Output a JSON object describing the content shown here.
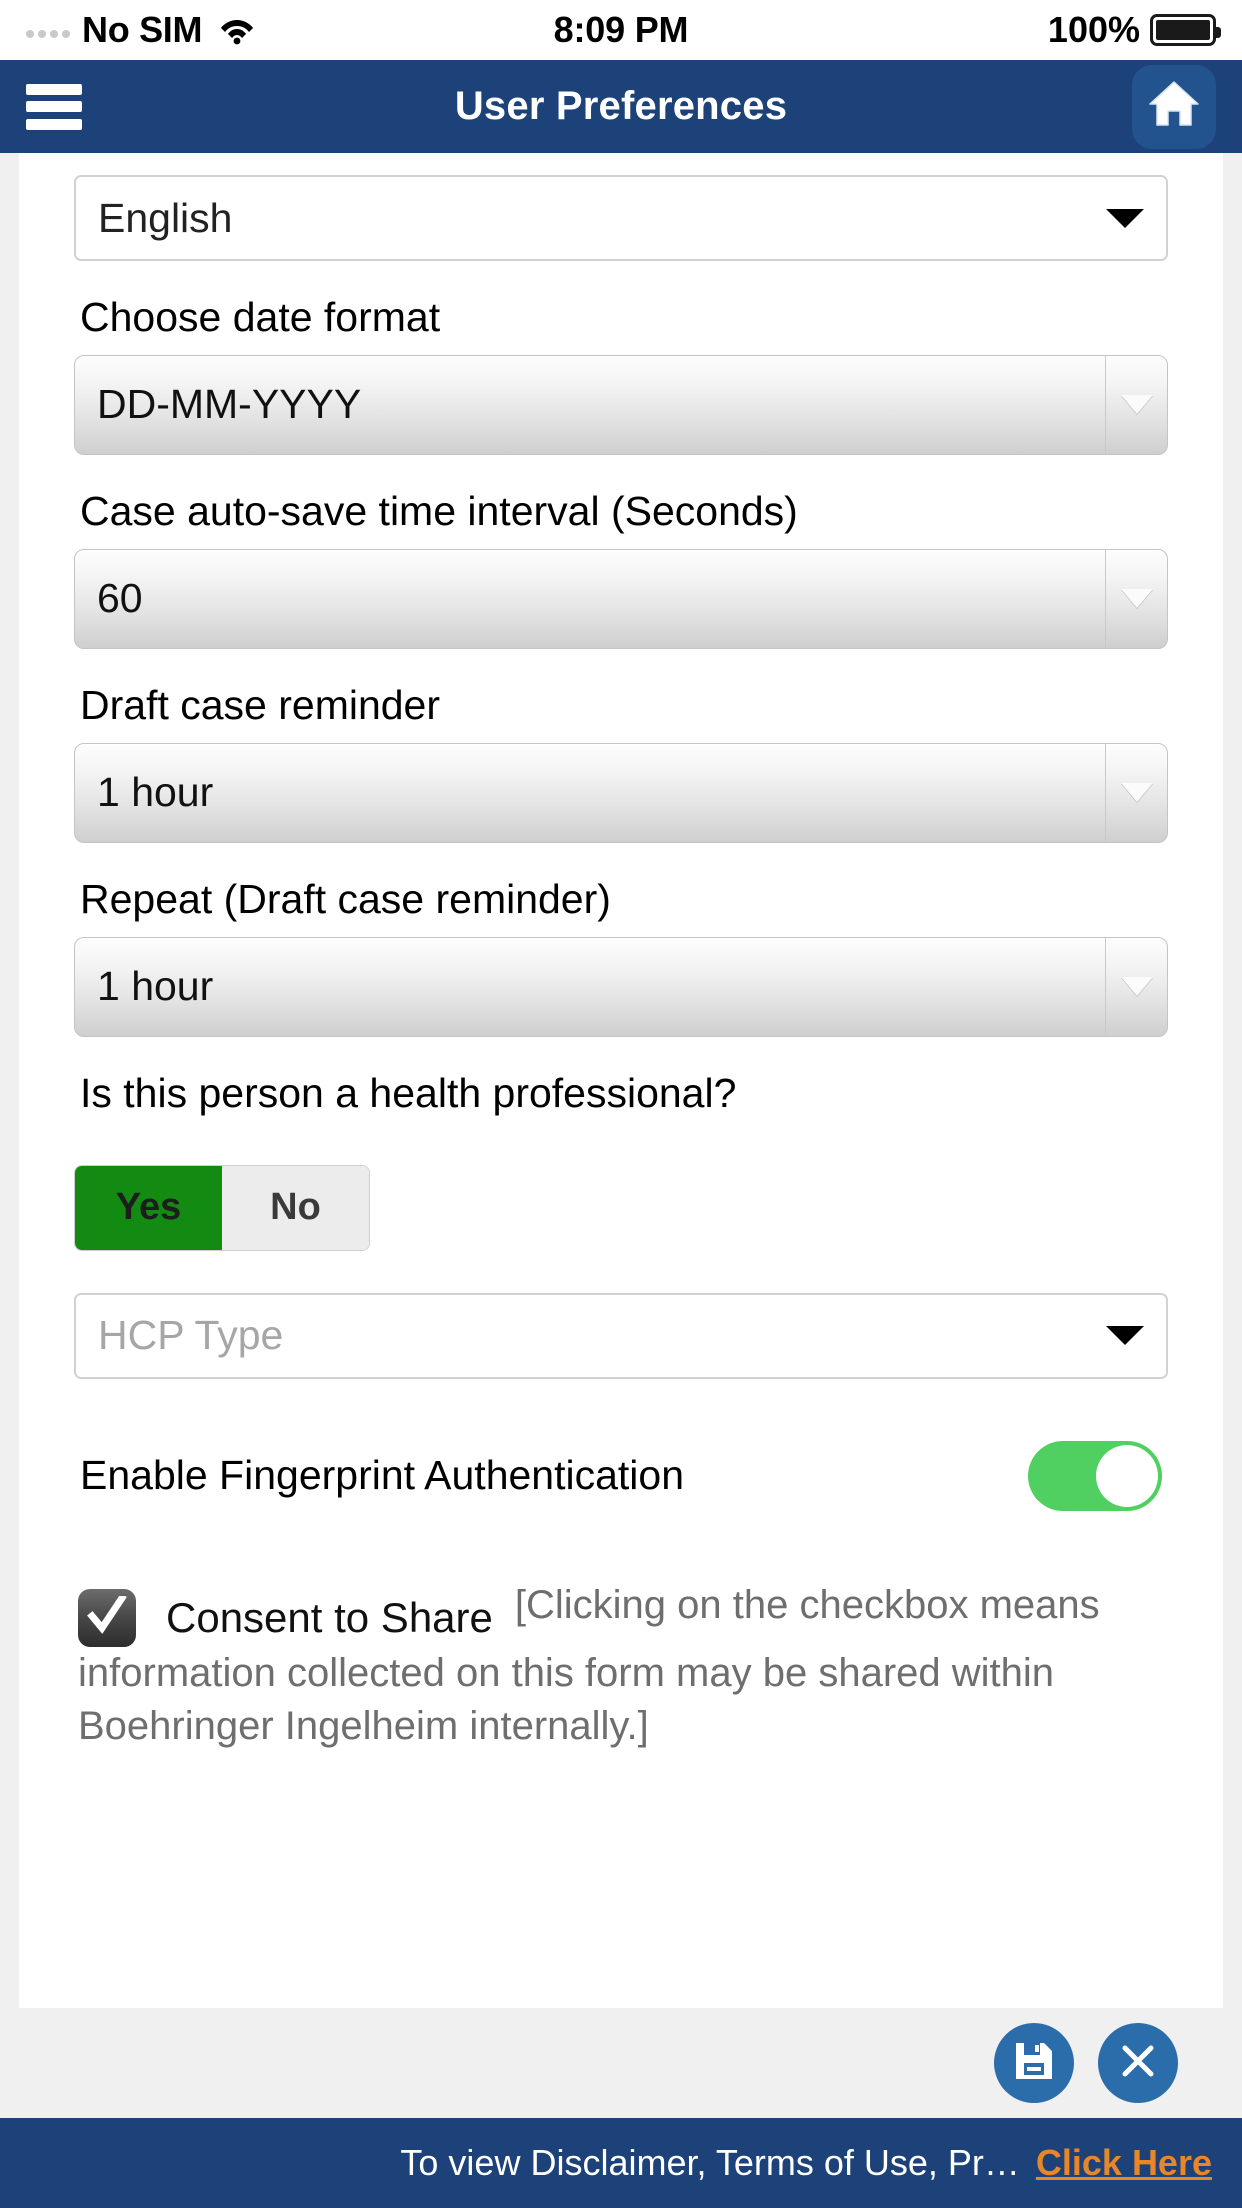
{
  "statusbar": {
    "carrier": "No SIM",
    "time": "8:09 PM",
    "battery_percent": "100%",
    "signal_icon": "signal-dots-icon",
    "wifi_icon": "wifi-icon",
    "battery_icon": "battery-full-icon"
  },
  "navbar": {
    "title": "User Preferences",
    "menu_icon": "hamburger-menu-icon",
    "home_icon": "home-icon"
  },
  "form": {
    "language": {
      "label": "",
      "value": "English",
      "caret_icon": "chevron-down-icon"
    },
    "date_format": {
      "label": "Choose date format",
      "value": "DD-MM-YYYY",
      "caret_icon": "chevron-down-icon"
    },
    "autosave": {
      "label": "Case auto-save time interval (Seconds)",
      "value": "60",
      "caret_icon": "chevron-down-icon"
    },
    "draft_reminder": {
      "label": "Draft case reminder",
      "value": "1 hour",
      "caret_icon": "chevron-down-icon"
    },
    "repeat_reminder": {
      "label": "Repeat (Draft case reminder)",
      "value": "1 hour",
      "caret_icon": "chevron-down-icon"
    },
    "health_professional": {
      "label": "Is this person a health professional?",
      "yes_label": "Yes",
      "no_label": "No",
      "selected": "Yes"
    },
    "hcp_type": {
      "placeholder": "HCP Type",
      "value": "",
      "caret_icon": "chevron-down-icon"
    },
    "fingerprint": {
      "label": "Enable Fingerprint Authentication",
      "state": "on"
    },
    "consent": {
      "checked": true,
      "check_icon": "checkmark-icon",
      "title": "Consent to Share",
      "note": "[Clicking on the checkbox means information collected on this form may be shared within Boehringer Ingelheim internally.]"
    }
  },
  "actions": {
    "save_icon": "floppy-disk-save-icon",
    "cancel_icon": "close-x-icon"
  },
  "footer": {
    "text": "To view Disclaimer, Terms of Use, Pr…",
    "link": "Click Here"
  },
  "colors": {
    "navy": "#1c4279",
    "green_selected": "#138b12",
    "toggle_green": "#4fd061",
    "action_blue": "#2b6cab",
    "link_orange": "#e8862a"
  }
}
